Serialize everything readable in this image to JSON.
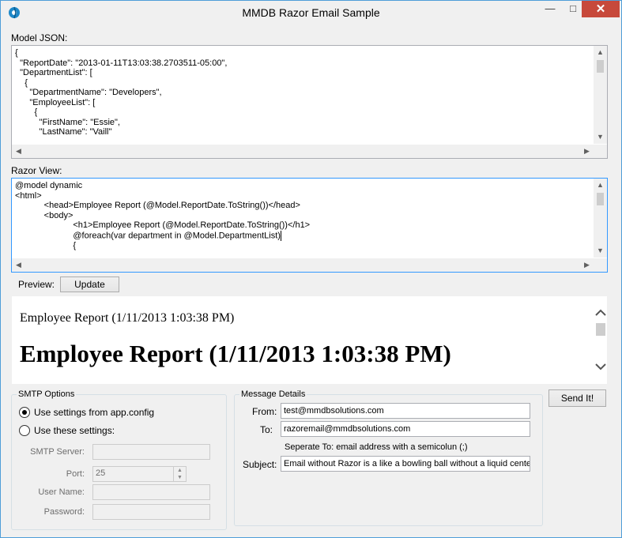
{
  "window": {
    "title": "MMDB Razor Email Sample",
    "minimize": "—",
    "maximize": "□",
    "close": "✕"
  },
  "model_json": {
    "label": "Model JSON:",
    "lines": [
      "{",
      "  \"ReportDate\": \"2013-01-11T13:03:38.2703511-05:00\",",
      "  \"DepartmentList\": [",
      "    {",
      "      \"DepartmentName\": \"Developers\",",
      "      \"EmployeeList\": [",
      "        {",
      "          \"FirstName\": \"Essie\",",
      "          \"LastName\": \"Vaill\""
    ]
  },
  "razor_view": {
    "label": "Razor View:",
    "lines": [
      "@model dynamic",
      "<html>",
      "            <head>Employee Report (@Model.ReportDate.ToString())</head>",
      "            <body>",
      "                        <h1>Employee Report (@Model.ReportDate.ToString())</h1>",
      "                        @foreach(var department in @Model.DepartmentList)",
      "                        {"
    ]
  },
  "preview": {
    "label": "Preview:",
    "update_button": "Update",
    "paragraph": "Employee Report (1/11/2013 1:03:38 PM)",
    "heading": "Employee Report (1/11/2013 1:03:38 PM)"
  },
  "smtp": {
    "legend": "SMTP Options",
    "option_app_config": "Use settings from app.config",
    "option_custom": "Use these settings:",
    "selected": "app.config",
    "server_label": "SMTP Server:",
    "server_value": "",
    "port_label": "Port:",
    "port_value": "25",
    "username_label": "User Name:",
    "username_value": "",
    "password_label": "Password:",
    "password_value": ""
  },
  "message": {
    "legend": "Message Details",
    "from_label": "From:",
    "from_value": "test@mmdbsolutions.com",
    "to_label": "To:",
    "to_value": "razoremail@mmdbsolutions.com",
    "hint": "Seperate To: email address with a semicolun (;)",
    "subject_label": "Subject:",
    "subject_value": "Email without Razor is a like a bowling ball without a liquid center"
  },
  "send_button": "Send It!",
  "scroll_arrows": {
    "up": "▲",
    "down": "▼",
    "left": "◀",
    "right": "▶"
  },
  "colors": {
    "close_button": "#c7493b",
    "focus_border": "#3399ff",
    "window_border": "#4f9dd8"
  }
}
